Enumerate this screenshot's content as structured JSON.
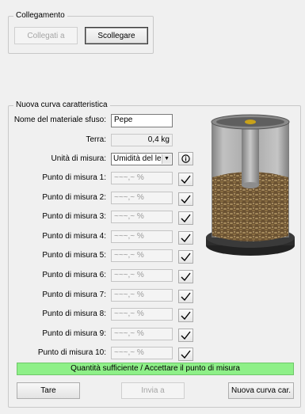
{
  "connection": {
    "title": "Collegamento",
    "connect_label": "Collegati a",
    "disconnect_label": "Scollegare"
  },
  "curve": {
    "title": "Nuova curva caratteristica",
    "material_label": "Nome del materiale sfuso:",
    "material_value": "Pepe",
    "earth_label": "Terra:",
    "earth_value": "0,4 kg",
    "unit_label": "Unità di misura:",
    "unit_value": "Umidità del leg",
    "points": [
      {
        "label": "Punto di misura 1:",
        "value": "~~~,~ %"
      },
      {
        "label": "Punto di misura 2:",
        "value": "~~~,~ %"
      },
      {
        "label": "Punto di misura 3:",
        "value": "~~~,~ %"
      },
      {
        "label": "Punto di misura 4:",
        "value": "~~~,~ %"
      },
      {
        "label": "Punto di misura 5:",
        "value": "~~~,~ %"
      },
      {
        "label": "Punto di misura 6:",
        "value": "~~~,~ %"
      },
      {
        "label": "Punto di misura 7:",
        "value": "~~~,~ %"
      },
      {
        "label": "Punto di misura 8:",
        "value": "~~~,~ %"
      },
      {
        "label": "Punto di misura 9:",
        "value": "~~~,~ %"
      },
      {
        "label": "Punto di misura 10:",
        "value": "~~~,~ %"
      }
    ],
    "status_text": "Quantità sufficiente / Accettare il punto di misura",
    "status_color": "#8ef088",
    "tare_label": "Tare",
    "send_label": "Invia a",
    "new_curve_label": "Nuova curva car."
  }
}
